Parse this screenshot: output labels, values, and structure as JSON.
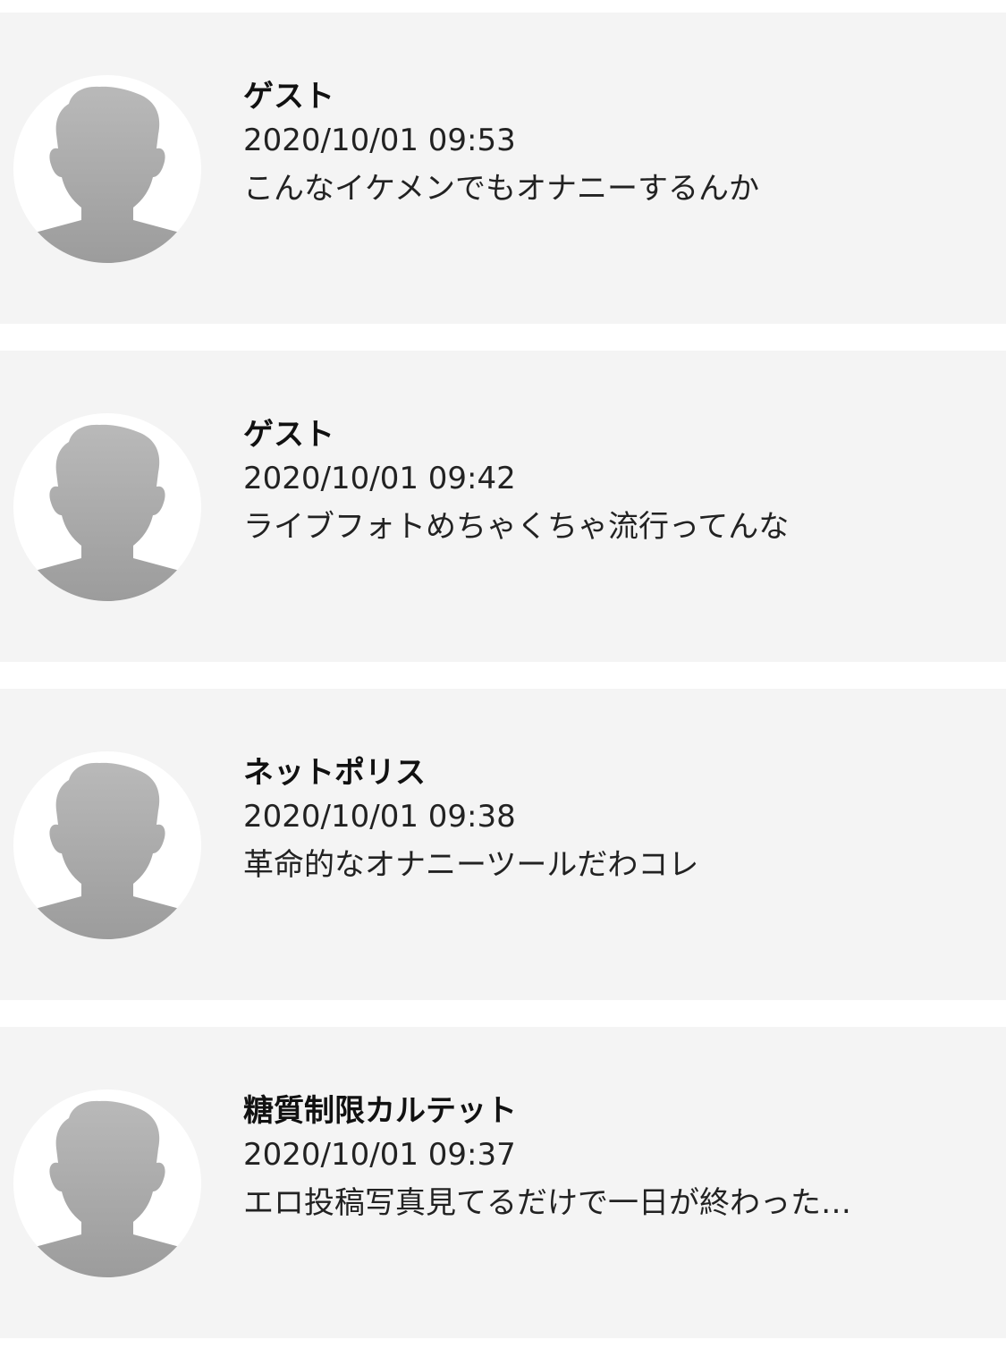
{
  "comments": [
    {
      "author": "ゲスト",
      "timestamp": "2020/10/01 09:53",
      "message": "こんなイケメンでもオナニーするんか",
      "avatar_icon": "default-user-silhouette-icon"
    },
    {
      "author": "ゲスト",
      "timestamp": "2020/10/01 09:42",
      "message": "ライブフォトめちゃくちゃ流行ってんな",
      "avatar_icon": "default-user-silhouette-icon"
    },
    {
      "author": "ネットポリス",
      "timestamp": "2020/10/01 09:38",
      "message": "革命的なオナニーツールだわコレ",
      "avatar_icon": "default-user-silhouette-icon"
    },
    {
      "author": "糖質制限カルテット",
      "timestamp": "2020/10/01 09:37",
      "message": "エロ投稿写真見てるだけで一日が終わった…",
      "avatar_icon": "default-user-silhouette-icon"
    }
  ],
  "colors": {
    "card_background": "#f4f4f4",
    "page_background": "#ffffff",
    "avatar_silhouette": "#a8a8a8"
  }
}
